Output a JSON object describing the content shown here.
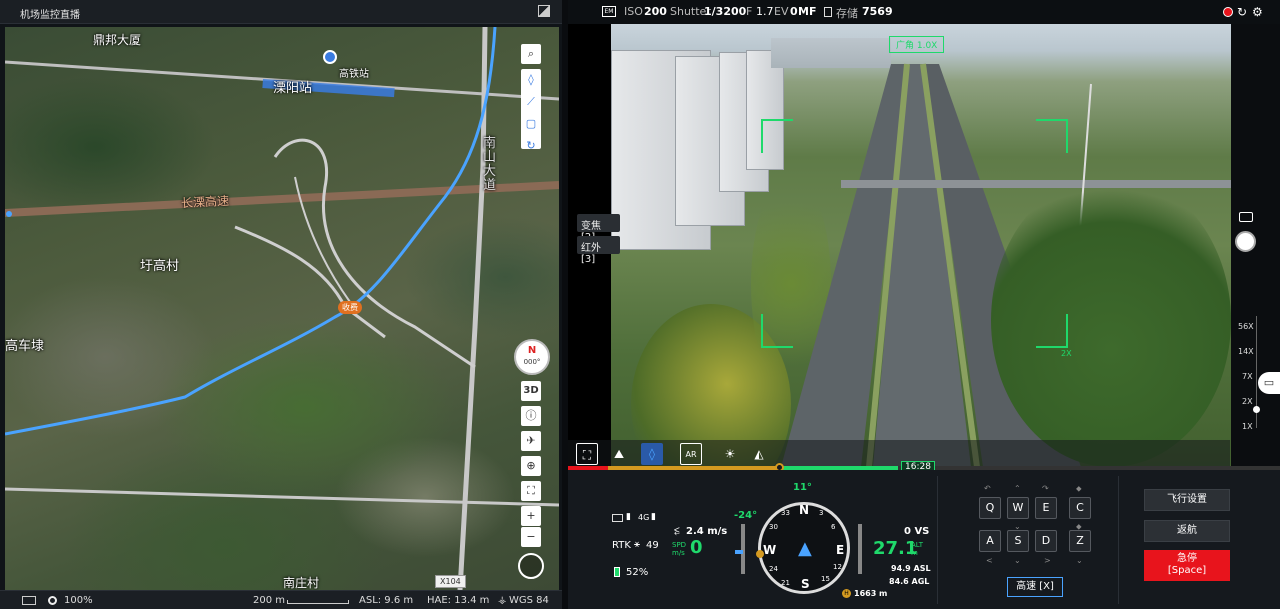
{
  "left_panel": {
    "title": "机场监控直播",
    "expand_icon": "expand-icon",
    "map_labels": {
      "dingbang": "鼎邦大厦",
      "liyang_station": "溧阳站",
      "hsr_station": "高铁站",
      "nanshan_road": "南山大道",
      "changliu_expressway": "长溧高速",
      "yugao_village": "圩高村",
      "gaochedai": "高车埭",
      "nanzhuang_village": "南庄村",
      "toll": "收费",
      "x104": "X104"
    },
    "compass": {
      "letter": "N",
      "heading": "000°"
    },
    "map_tools": [
      "search-icon",
      "point-icon",
      "line-icon",
      "box-icon",
      "refresh-icon"
    ],
    "map_side_tools": {
      "view_3d": "3D"
    },
    "zoom_in": "+",
    "zoom_out": "−",
    "status": {
      "opacity": "100%",
      "scale": "200 m",
      "asl": "ASL: 9.6 m",
      "hae": "HAE: 13.4 m",
      "datum": "WGS 84"
    }
  },
  "camera": {
    "top_bar": {
      "iso_label": "ISO",
      "iso": "200",
      "shutter_label": "Shutter",
      "shutter": "1/3200",
      "f_label": "F",
      "f_value": "1.7",
      "ev_label": "EV",
      "ev": "0",
      "focus": "MF",
      "storage_label": "存储",
      "storage": "7569"
    },
    "overlay_tag": "广角 1.0X",
    "side_tags": [
      "变焦 [2]",
      "红外 [3]"
    ],
    "zoom_levels": [
      "56X",
      "14X",
      "7X",
      "2X",
      "1X"
    ],
    "bracket_label": "2X",
    "timeline_time": "16:28"
  },
  "dashboard": {
    "rtk": "RTK",
    "rtk_sats": "49",
    "battery": "52%",
    "signal": "4G",
    "hspeed": "2.4 m/s",
    "spd_label": "SPD\nm/s",
    "spd": "0",
    "gimbal": "-24°",
    "heading": "11°",
    "compass_letters": [
      "N",
      "E",
      "S",
      "W"
    ],
    "compass_ticks": [
      "3",
      "6",
      "12",
      "15",
      "21",
      "24",
      "30",
      "33"
    ],
    "vs": "0 VS",
    "alt": "27.1",
    "alt_label": "ALT\nm",
    "asl": "94.9 ASL",
    "agl": "84.6 AGL",
    "home_dist": "1663 m",
    "keys_top": [
      "Q",
      "W",
      "E",
      "C"
    ],
    "keys_bottom": [
      "A",
      "S",
      "D",
      "Z"
    ],
    "speed_mode": "高速 [X]",
    "flight_settings": "飞行设置",
    "return_home": "返航",
    "emergency_stop": "急停",
    "emergency_key": "[Space]"
  },
  "colors": {
    "accent_green": "#1fd96b",
    "emergency_red": "#e8141c",
    "route_blue": "#4aa3ff"
  }
}
